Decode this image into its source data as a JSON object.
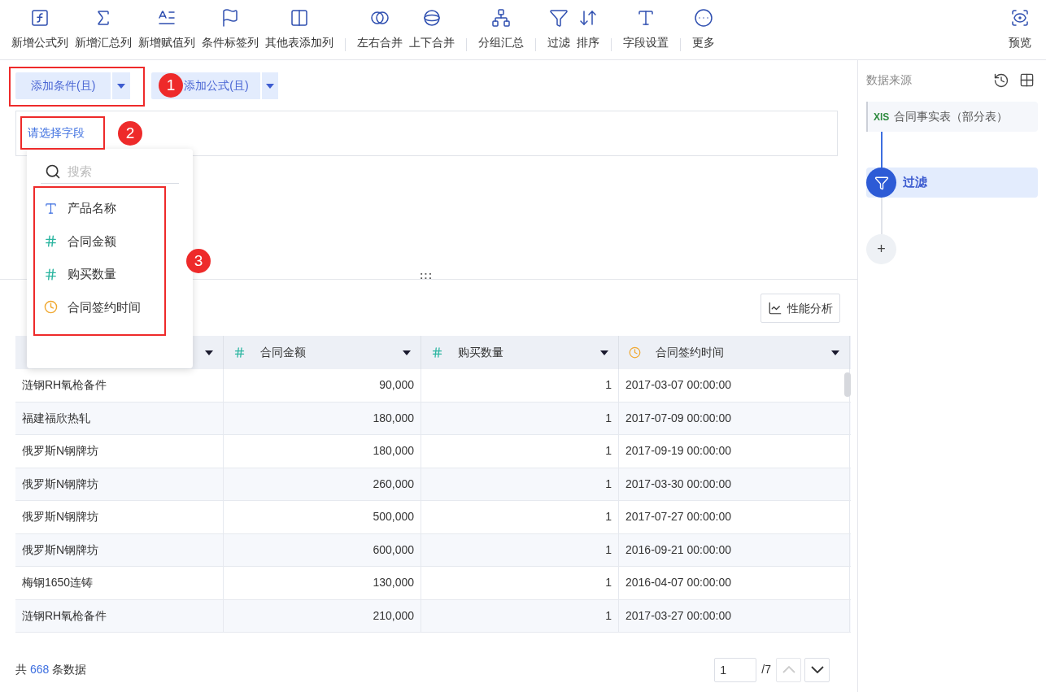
{
  "toolbar": {
    "groups": [
      [
        {
          "label": "新增公式列",
          "kind": "formula"
        },
        {
          "label": "新增汇总列",
          "kind": "sum"
        },
        {
          "label": "新增赋值列",
          "kind": "assign"
        },
        {
          "label": "条件标签列",
          "kind": "flag"
        },
        {
          "label": "其他表添加列",
          "kind": "add_column"
        }
      ],
      [
        {
          "label": "左右合并",
          "kind": "merge_lr"
        },
        {
          "label": "上下合并",
          "kind": "merge_tb"
        }
      ],
      [
        {
          "label": "分组汇总",
          "kind": "group"
        }
      ],
      [
        {
          "label": "过滤",
          "kind": "filter"
        },
        {
          "label": "排序",
          "kind": "sort"
        }
      ],
      [
        {
          "label": "字段设置",
          "kind": "field_settings"
        }
      ],
      [
        {
          "label": "更多",
          "kind": "more"
        }
      ]
    ],
    "preview": {
      "label": "预览",
      "kind": "preview"
    }
  },
  "condition_button": {
    "label": "添加条件(且)"
  },
  "formula_button": {
    "label": "添加公式(且)"
  },
  "field_select": {
    "label": "请选择字段"
  },
  "field_dropdown": {
    "search": {
      "placeholder": "搜索"
    },
    "items": [
      {
        "label": "产品名称",
        "kind": "text"
      },
      {
        "label": "合同金额",
        "kind": "number"
      },
      {
        "label": "购买数量",
        "kind": "number"
      },
      {
        "label": "合同签约时间",
        "kind": "date"
      }
    ]
  },
  "resize_handle": ":::",
  "annotations": [
    "1",
    "2",
    "3"
  ],
  "performance_button": {
    "label": "性能分析"
  },
  "table": {
    "columns": [
      {
        "kind": "text"
      },
      {
        "label": "合同金额",
        "kind": "number"
      },
      {
        "label": "购买数量",
        "kind": "number"
      },
      {
        "label": "合同签约时间",
        "kind": "date"
      }
    ],
    "rows": [
      [
        "涟钢RH氧枪备件",
        "90,000",
        "1",
        "2017-03-07 00:00:00"
      ],
      [
        "福建福欣热轧",
        "180,000",
        "1",
        "2017-07-09 00:00:00"
      ],
      [
        "俄罗斯N钢牌坊",
        "180,000",
        "1",
        "2017-09-19 00:00:00"
      ],
      [
        "俄罗斯N钢牌坊",
        "260,000",
        "1",
        "2017-03-30 00:00:00"
      ],
      [
        "俄罗斯N钢牌坊",
        "500,000",
        "1",
        "2017-07-27 00:00:00"
      ],
      [
        "俄罗斯N钢牌坊",
        "600,000",
        "1",
        "2016-09-21 00:00:00"
      ],
      [
        "梅钢1650连铸",
        "130,000",
        "1",
        "2016-04-07 00:00:00"
      ],
      [
        "涟钢RH氧枪备件",
        "210,000",
        "1",
        "2017-03-27 00:00:00"
      ]
    ]
  },
  "footer": {
    "prefix": "共",
    "count": "668",
    "suffix": "条数据"
  },
  "pagination": {
    "page": "1",
    "total": "/7"
  },
  "side_panel": {
    "title": "数据来源",
    "source": {
      "file_type": "XlS",
      "label": "合同事实表（部分表）"
    },
    "steps": [
      {
        "label": "过滤",
        "kind": "filter",
        "selected": true
      }
    ],
    "add": "+"
  }
}
